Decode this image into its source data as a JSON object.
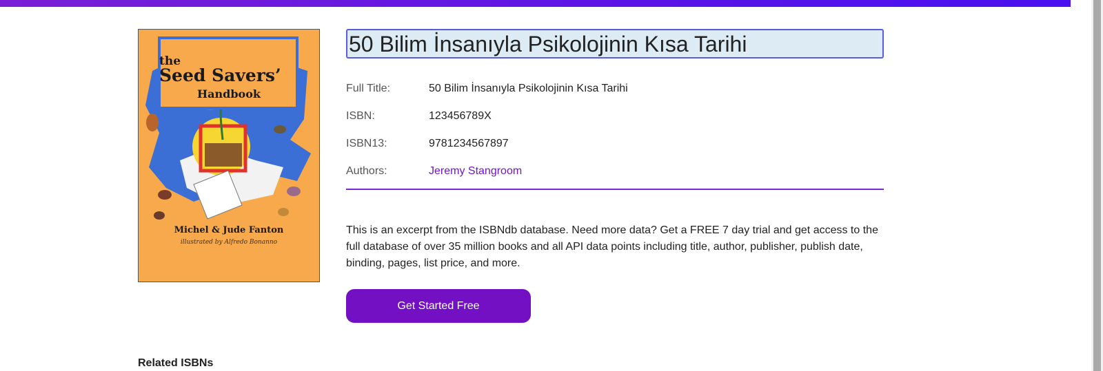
{
  "book": {
    "title": "50 Bilim İnsanıyla Psikolojinin Kısa Tarihi",
    "cover": {
      "title_line1": "the",
      "title_line2": "Seed Savers’",
      "title_line3": "Handbook",
      "authors": "Michel & Jude Fanton",
      "illustrator": "illustrated by Alfredo Bonanno"
    },
    "details": [
      {
        "label": "Full Title:",
        "value": "50 Bilim İnsanıyla Psikolojinin Kısa Tarihi"
      },
      {
        "label": "ISBN:",
        "value": "123456789X"
      },
      {
        "label": "ISBN13:",
        "value": "9781234567897"
      },
      {
        "label": "Authors:",
        "value": "Jeremy Stangroom"
      }
    ]
  },
  "excerpt": "This is an excerpt from the ISBNdb database. Need more data? Get a FREE 7 day trial and get access to the full database of over 35 million books and all API data points including title, author, publisher, publish date, binding, pages, list price, and more.",
  "cta_label": "Get Started Free",
  "related_heading": "Related ISBNs",
  "colors": {
    "accent": "#7310c4",
    "link": "#6e16c8",
    "title_bg": "#dcebf4",
    "title_border": "#5b5be0"
  }
}
